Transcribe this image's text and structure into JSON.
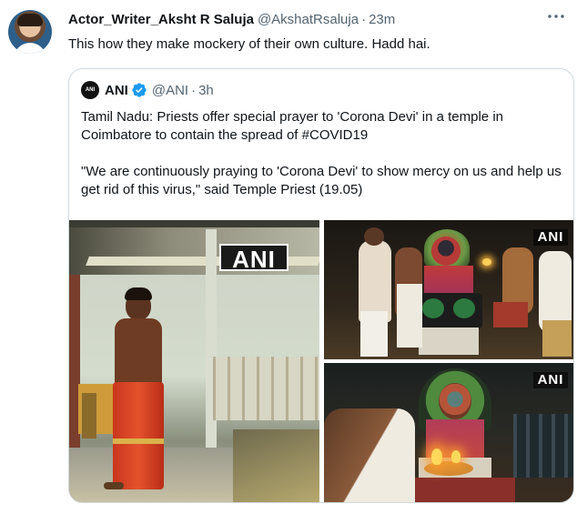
{
  "tweet": {
    "author_name": "Actor_Writer_Aksht R Saluja",
    "handle": "@AkshatRsaluja",
    "separator": "·",
    "time": "23m",
    "text": "This how they make mockery of their own culture. Hadd hai.",
    "more_icon": "more-horizontal-icon"
  },
  "quote": {
    "avatar_label": "ANI",
    "name": "ANI",
    "verified_icon": "verified-badge-icon",
    "handle": "@ANI",
    "separator": "·",
    "time": "3h",
    "paragraph1": "Tamil Nadu: Priests offer special prayer to 'Corona Devi' in a temple in Coimbatore to contain the spread of #COVID19",
    "paragraph2": "\"We are continuously praying to 'Corona Devi' to show mercy on us and help us get rid of this virus,\" said Temple Priest (19.05)",
    "media": {
      "watermark_large": "ANI",
      "watermark_top_right": "ANI",
      "watermark_bottom_right": "ANI"
    }
  },
  "colors": {
    "text_primary": "#0f1419",
    "text_secondary": "#536471",
    "border": "#cfd9de",
    "verified_blue": "#1d9bf0"
  }
}
